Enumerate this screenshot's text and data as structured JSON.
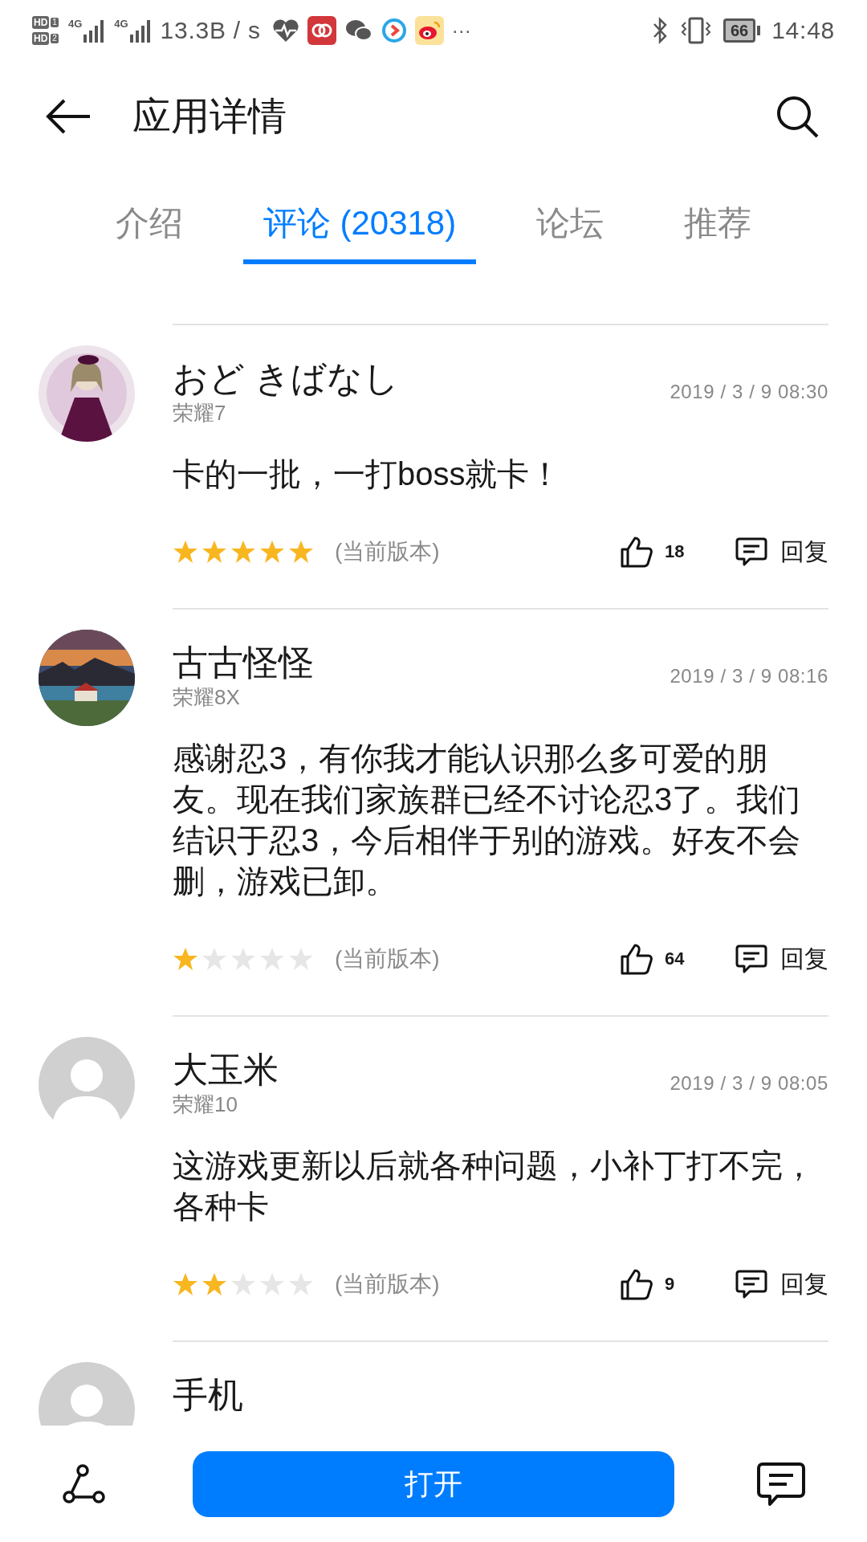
{
  "status_bar": {
    "sims": [
      {
        "badge": "HD",
        "slot": "1",
        "network": "4G"
      },
      {
        "badge": "HD",
        "slot": "2",
        "network": "4G"
      }
    ],
    "speed": "13.3B / s",
    "more": "···",
    "battery": "66",
    "time": "14:48"
  },
  "header": {
    "title": "应用详情"
  },
  "tabs": [
    {
      "label": "介绍",
      "selected": false
    },
    {
      "label": "评论 (20318)",
      "selected": true
    },
    {
      "label": "论坛",
      "selected": false
    },
    {
      "label": "推荐",
      "selected": false
    }
  ],
  "reviews": [
    {
      "user": "おど きばなし",
      "device": "荣耀7",
      "date": "2019 / 3 / 9 08:30",
      "content": "卡的一批，一打boss就卡！",
      "stars": 5,
      "version": "(当前版本)",
      "likes": "18",
      "reply": "回复"
    },
    {
      "user": "古古怪怪",
      "device": "荣耀8X",
      "date": "2019 / 3 / 9 08:16",
      "content": "感谢忍3，有你我才能认识那么多可爱的朋友。现在我们家族群已经不讨论忍3了。我们结识于忍3，今后相伴于别的游戏。好友不会删，游戏已卸。",
      "stars": 1,
      "version": "(当前版本)",
      "likes": "64",
      "reply": "回复"
    },
    {
      "avatar": {
        "kind": "icon"
      },
      "user": "大玉米",
      "device": "荣耀10",
      "date": "2019 / 3 / 9 08:05",
      "content": "这游戏更新以后就各种问题，小补丁打不完，各种卡",
      "stars": 2,
      "version": "(当前版本)",
      "likes": "9",
      "reply": "回复"
    },
    {
      "avatar": {
        "kind": "icon"
      },
      "user": "手机"
    }
  ],
  "bottom_bar": {
    "button": "打开"
  }
}
